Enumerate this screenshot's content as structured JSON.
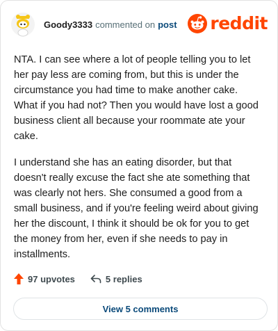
{
  "comment": {
    "username": "Goody3333",
    "action": "commented on",
    "target": "post",
    "paragraphs": [
      "NTA. I can see where a lot of people telling you to let her pay less are coming from, but this is under the circumstance you had time to make another cake. What if you had not? Then you would have lost a good business client all because your roommate ate your cake.",
      "I understand she has an eating disorder, but that doesn't really excuse the fact she ate something that was clearly not hers. She consumed a good from a small business, and if you're feeling weird about giving her the discount, I think it should be ok for you to get the money from her, even if she needs to pay in installments."
    ]
  },
  "brand": {
    "name": "reddit",
    "color": "#ff4500",
    "icon": "reddit-snoo-icon"
  },
  "footer": {
    "upvotes": "97 upvotes",
    "upvote_icon": "upvote-arrow-icon",
    "upvote_color": "#ff4500",
    "replies": "5 replies",
    "reply_icon": "reply-arrow-icon"
  },
  "view_comments_label": "View 5 comments"
}
